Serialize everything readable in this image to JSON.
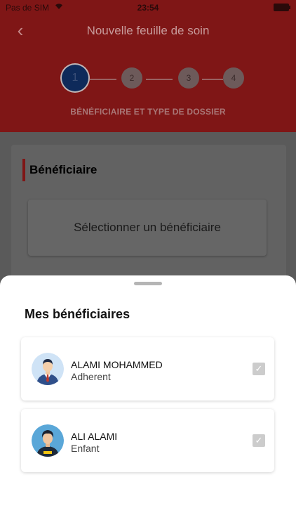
{
  "status_bar": {
    "carrier": "Pas de SIM",
    "time": "23:54"
  },
  "header": {
    "title": "Nouvelle feuille de soin",
    "steps": [
      "1",
      "2",
      "3",
      "4"
    ],
    "active_step": 1,
    "subtitle": "BÉNÉFICIAIRE ET TYPE DE DOSSIER"
  },
  "content": {
    "section_title": "Bénéficiaire",
    "select_label": "Sélectionner un bénéficiaire"
  },
  "sheet": {
    "title": "Mes bénéficiaires",
    "beneficiaries": [
      {
        "name": "ALAMI MOHAMMED",
        "role": "Adherent",
        "avatar_icon": "man-in-suit-avatar-icon"
      },
      {
        "name": "ALI ALAMI",
        "role": "Enfant",
        "avatar_icon": "young-man-avatar-icon"
      }
    ]
  },
  "colors": {
    "header_red": "#7f1616",
    "accent_red": "#a01c1c",
    "step_blue": "#0e2a5a"
  }
}
